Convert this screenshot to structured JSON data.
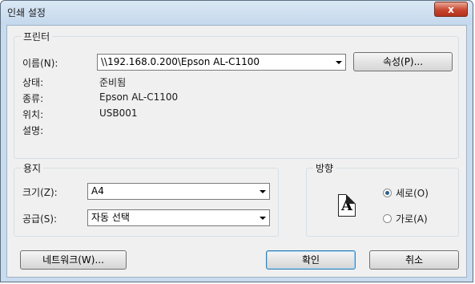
{
  "window": {
    "title": "인쇄 설정",
    "close_label": "x"
  },
  "printer": {
    "legend": "프린터",
    "name_label": "이름(N):",
    "name_value": "\\\\192.168.0.200\\Epson AL-C1100",
    "properties_label": "속성(P)...",
    "status_label": "상태:",
    "status_value": "준비됨",
    "type_label": "종류:",
    "type_value": "Epson AL-C1100",
    "where_label": "위치:",
    "where_value": "USB001",
    "comment_label": "설명:",
    "comment_value": ""
  },
  "paper": {
    "legend": "용지",
    "size_label": "크기(Z):",
    "size_value": "A4",
    "source_label": "공급(S):",
    "source_value": "자동 선택"
  },
  "orientation": {
    "legend": "방향",
    "icon_letter": "A",
    "portrait_label": "세로(O)",
    "landscape_label": "가로(A)",
    "selected": "portrait"
  },
  "buttons": {
    "network": "네트워크(W)...",
    "ok": "확인",
    "cancel": "취소"
  }
}
